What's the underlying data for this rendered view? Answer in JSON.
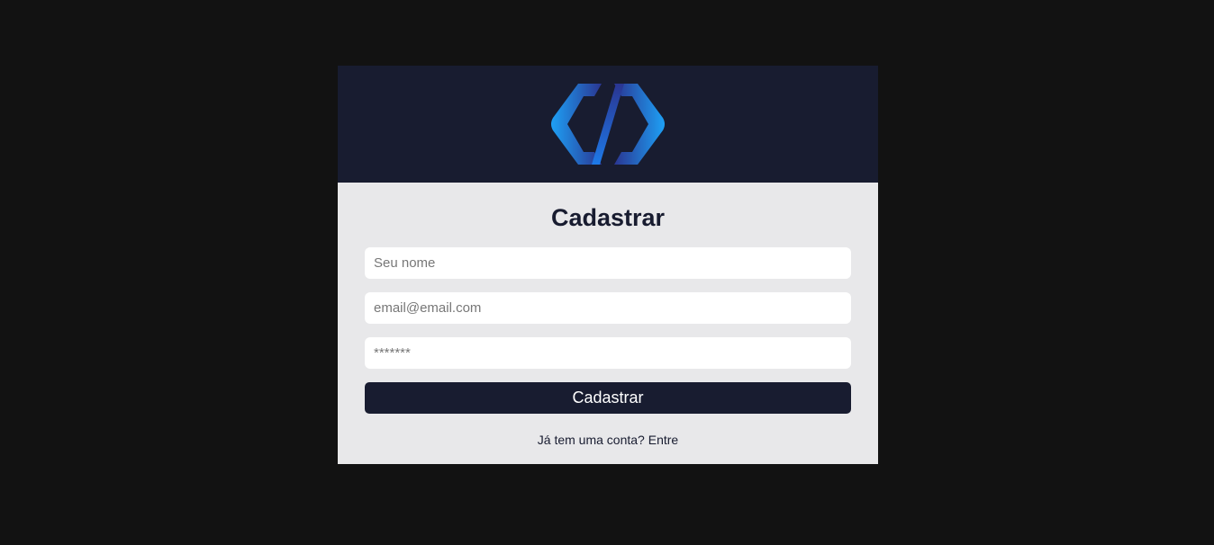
{
  "header": {
    "logo_icon": "code-brackets-logo-icon",
    "colors": {
      "background": "#181c30",
      "logo_light": "#1ea0f5",
      "logo_dark": "#2a3591"
    }
  },
  "form": {
    "title": "Cadastrar",
    "name_field": {
      "placeholder": "Seu nome",
      "value": ""
    },
    "email_field": {
      "placeholder": "email@email.com",
      "value": ""
    },
    "password_field": {
      "placeholder": "*******",
      "value": ""
    },
    "submit_label": "Cadastrar",
    "login_prompt": "Já tem uma conta?",
    "login_link": "Entre"
  },
  "colors": {
    "page_background": "#121212",
    "card_background": "#e8e8ea",
    "primary": "#181c30"
  }
}
